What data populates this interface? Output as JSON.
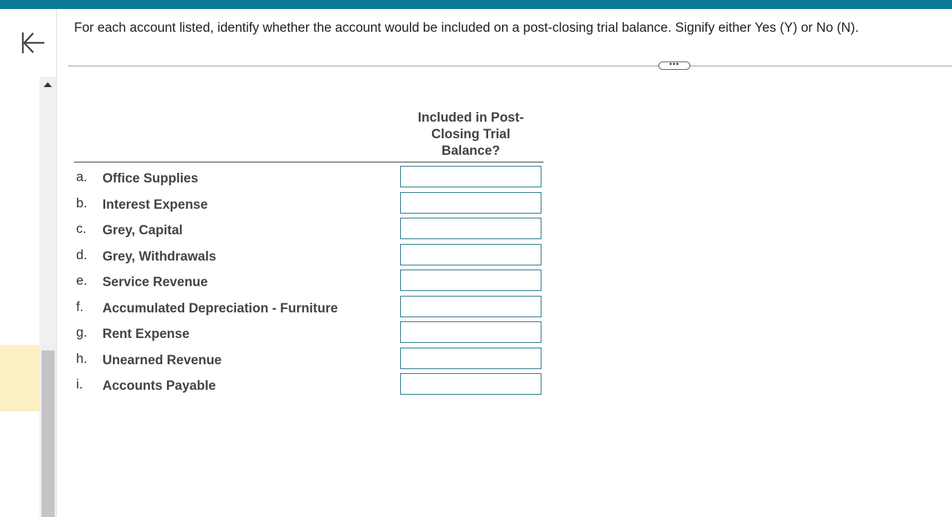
{
  "instructions": "For each account listed, identify whether the account would be included on a post-closing trial balance. Signify either Yes (Y) or No (N).",
  "more_button_label": "•••",
  "column_header": {
    "line1": "Included in Post-",
    "line2": "Closing Trial",
    "line3": "Balance?"
  },
  "accounts": [
    {
      "letter": "a.",
      "label": "Office Supplies",
      "value": ""
    },
    {
      "letter": "b.",
      "label": "Interest Expense",
      "value": ""
    },
    {
      "letter": "c.",
      "label": "Grey, Capital",
      "value": ""
    },
    {
      "letter": "d.",
      "label": "Grey, Withdrawals",
      "value": ""
    },
    {
      "letter": "e.",
      "label": "Service Revenue",
      "value": ""
    },
    {
      "letter": "f.",
      "label": "Accumulated Depreciation - Furniture",
      "value": ""
    },
    {
      "letter": "g.",
      "label": "Rent Expense",
      "value": ""
    },
    {
      "letter": "h.",
      "label": "Unearned Revenue",
      "value": ""
    },
    {
      "letter": "i.",
      "label": "Accounts Payable",
      "value": ""
    }
  ],
  "colors": {
    "top_bar": "#0b7a94",
    "input_border": "#1b6f83",
    "highlight": "#fcefc4"
  },
  "icons": {
    "collapse": "collapse-left-icon",
    "scroll_up": "scroll-up-icon"
  }
}
